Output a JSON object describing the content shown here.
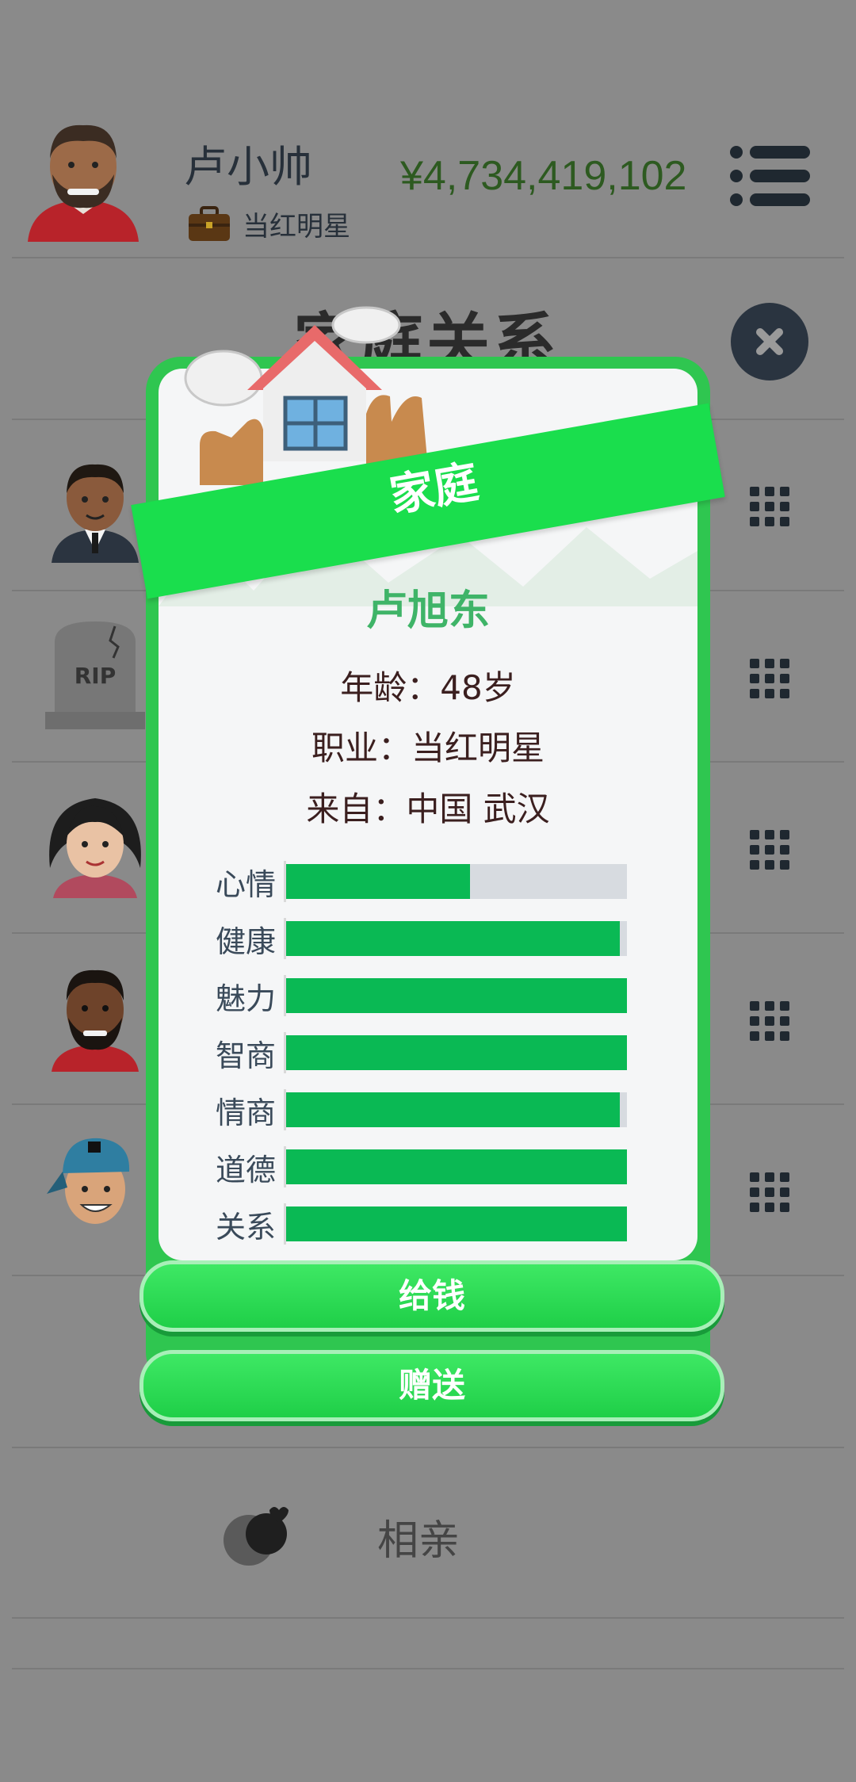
{
  "header": {
    "player_name": "卢小帅",
    "job": "当红明星",
    "money": "¥4,734,419,102"
  },
  "background": {
    "title": "家庭关系",
    "bottom_action": "相亲"
  },
  "modal": {
    "banner": "家庭",
    "name": "卢旭东",
    "age_line": "年龄：48岁",
    "job_line": "职业：当红明星",
    "from_line": "来自：中国 武汉",
    "stats": [
      {
        "label": "心情",
        "value": 0.54
      },
      {
        "label": "健康",
        "value": 0.98
      },
      {
        "label": "魅力",
        "value": 1.0
      },
      {
        "label": "智商",
        "value": 1.0
      },
      {
        "label": "情商",
        "value": 0.98
      },
      {
        "label": "道德",
        "value": 1.0
      },
      {
        "label": "关系",
        "value": 1.0
      }
    ],
    "buttons": {
      "give_money": "给钱",
      "gift": "赠送"
    }
  },
  "colors": {
    "accent_green": "#1ade4d",
    "bar_fill": "#0ab954",
    "money": "#2d5a20"
  },
  "icons": [
    "menu-icon",
    "briefcase-icon",
    "close-icon",
    "grid-icon",
    "house-icon",
    "dating-icon"
  ]
}
